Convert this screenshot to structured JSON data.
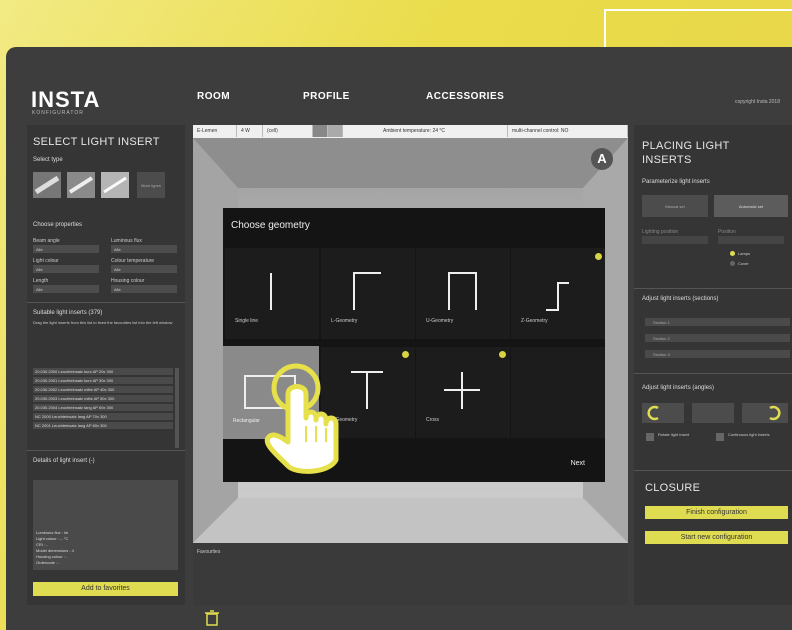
{
  "header": {
    "logo": "INSTA",
    "logo_sub": "KONFIGURATOR",
    "copyright": "copyright Insta 2018",
    "nav": [
      "ROOM",
      "PROFILE",
      "ACCESSORIES"
    ]
  },
  "toolbar": {
    "items": [
      "E-Lemen",
      "4 W",
      "(cell)",
      "",
      "",
      "Ambient temperature: 24 °C",
      "multi-channel control: NO"
    ]
  },
  "left": {
    "title": "SELECT LIGHT INSERT",
    "select_type": "Select type",
    "more_types": "More types",
    "choose_properties": "Choose properties",
    "props": [
      {
        "label": "Beam angle",
        "value": "Alle"
      },
      {
        "label": "Luminous flux",
        "value": "Alle"
      },
      {
        "label": "Light colour",
        "value": "Alle"
      },
      {
        "label": "Colour temperature",
        "value": "Alle"
      },
      {
        "label": "Length",
        "value": "Alle"
      },
      {
        "label": "Housing colour",
        "value": "Alle"
      }
    ],
    "suitable_title": "Suitable light inserts (379)",
    "suitable_hint": "Drag the light inserts from this list to fixed the favourites list into the left window",
    "list_rows": [
      "20.030.2000 Leuchteinsatz  kurz  AP  20x  300",
      "20.030.2001 Leuchteinsatz  kurz  AP  30x  300",
      "20.030.2002 Leuchteinsatz  mitte  AP  40x  300",
      "20.030.2003 Leuchteinsatz  mitte  AP  50x  300",
      "20.030.2004 Leuchteinsatz  lang  AP  60x  300",
      "NC  2000  Leuchteinsatz  lang  AP  70x  300",
      "NC  2001  Leuchteinsatz  lang  AP  80x  300"
    ],
    "details_title": "Details of light insert (-)",
    "details_lines": [
      "Luminous flux : lm",
      "Light colour : -- °C",
      "CRI : -",
      "Model dimensions : 4",
      "Housing colour : -",
      "Ordercode : -"
    ],
    "add_button": "Add to favorites"
  },
  "center": {
    "avatar_letter": "A",
    "favourites": "Favourites"
  },
  "modal": {
    "title": "Choose geometry",
    "cells": [
      "Single line",
      "L-Geometry",
      "U-Geometry",
      "Z-Geometry",
      "Rectangular",
      "T-Geometry",
      "Cross",
      ""
    ],
    "next": "Next"
  },
  "right": {
    "title": "PLACING LIGHT INSERTS",
    "parameterize": "Parameterize light inserts",
    "btn_a": "Manual set",
    "btn_b": "Automatic set",
    "field_a": "Lighting position",
    "field_b": "Position",
    "radio_a": "Lamps",
    "radio_b": "Cover",
    "adjust_sections": "Adjust light inserts (sections)",
    "sections": [
      "Section 1",
      "Section 2",
      "Section 3"
    ],
    "adjust_angles": "Adjust light inserts (angles)",
    "opt_a": "Rotate light insert",
    "opt_b": "Continuous light inserts",
    "closure": "CLOSURE",
    "finish": "Finish configuration",
    "start_new": "Start new configuration"
  },
  "colors": {
    "accent": "#e0dc52",
    "panel": "#353535",
    "modal": "#141414"
  },
  "icons": {
    "hand": "pointer-hand-icon",
    "trash": "trash-icon"
  }
}
